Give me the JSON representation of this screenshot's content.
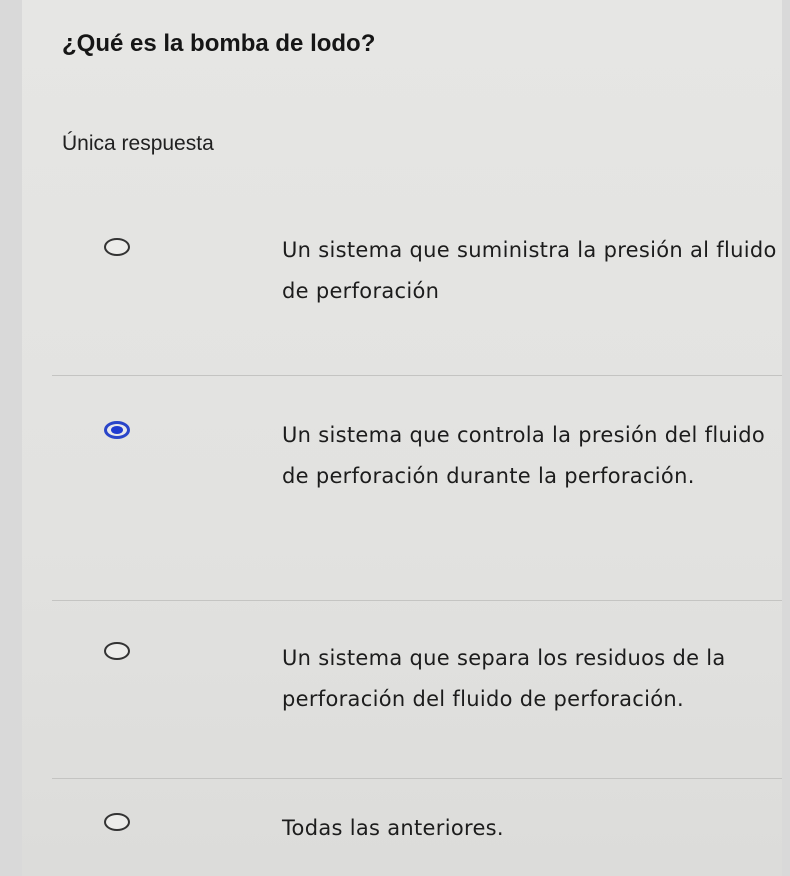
{
  "question": {
    "text": "¿Qué es la bomba de lodo?",
    "mode_label": "Única respuesta"
  },
  "options": [
    {
      "label": "Un sistema que suministra la presión al fluido de perforación",
      "selected": false
    },
    {
      "label": "Un sistema que controla la presión del fluido de perforación durante la perforación.",
      "selected": true
    },
    {
      "label": "Un sistema que separa los residuos de la perforación del fluido de perforación.",
      "selected": false
    },
    {
      "label": "Todas las anteriores.",
      "selected": false
    }
  ],
  "colors": {
    "selected_radio": "#1f3bd0",
    "background": "#e4e4e2"
  }
}
